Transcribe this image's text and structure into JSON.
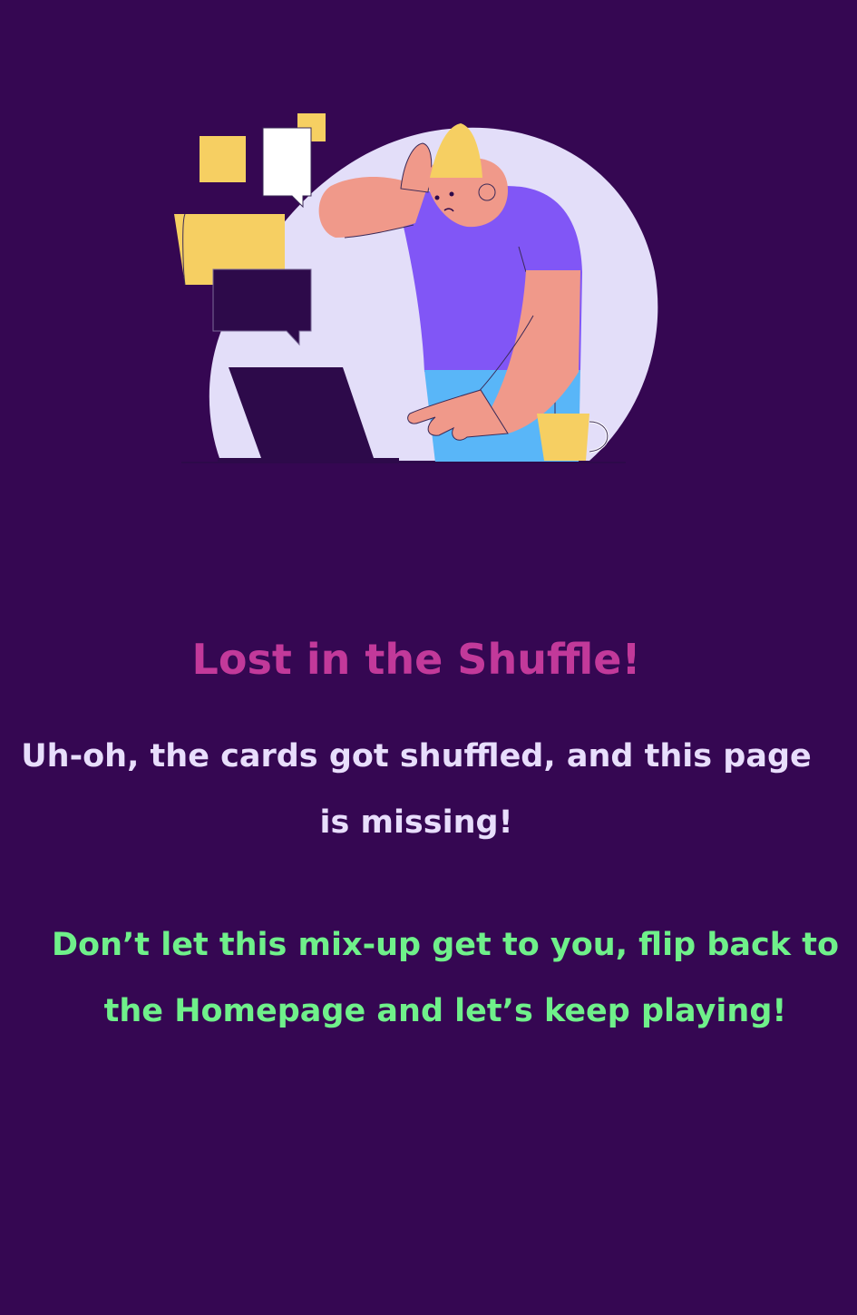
{
  "error_page": {
    "title": "Lost in the Shuffle!",
    "message": "Uh-oh, the cards got shuffled, and this page is missing!",
    "cta_before": "Don’t let this mix-up get to you, flip back to the ",
    "cta_link": "Homepage",
    "cta_after": " and let’s keep playing!"
  },
  "colors": {
    "background": "#350752",
    "title": "#c2399a",
    "message": "#e8defc",
    "cta": "#6ff08a"
  },
  "illustration": {
    "icon": "confused-person-at-laptop-illustration"
  }
}
